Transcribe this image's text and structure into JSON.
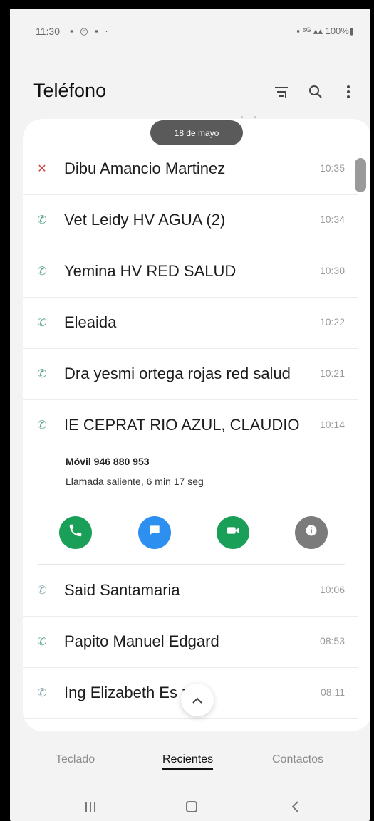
{
  "status_bar": {
    "time": "11:30",
    "left_icons": "▪ ◎ ▪ ·",
    "right_icons": "▪ ⁵ᴳ ▴▴ 100%▮"
  },
  "header": {
    "title": "Teléfono",
    "filter_icon": "filter-icon",
    "search_icon": "search-icon",
    "more_icon": "more-vert-icon"
  },
  "date_label": "18 de mayo",
  "calls_before": [
    {
      "name": "Dibu Amancio Martinez",
      "time": "10:35",
      "type": "missed"
    },
    {
      "name": "Vet Leidy HV AGUA (2)",
      "time": "10:34",
      "type": "incoming"
    },
    {
      "name": "Yemina HV RED SALUD",
      "time": "10:30",
      "type": "incoming"
    },
    {
      "name": "Eleaida",
      "time": "10:22",
      "type": "incoming"
    },
    {
      "name": "Dra yesmi ortega rojas red salud",
      "time": "10:21",
      "type": "incoming"
    },
    {
      "name": "IE CEPRAT RIO AZUL, CLAUDIO",
      "time": "10:14",
      "type": "incoming"
    }
  ],
  "expanded": {
    "number": "Móvil 946 880 953",
    "info": "Llamada saliente, 6 min 17 seg"
  },
  "calls_after": [
    {
      "name": "Said Santamaria",
      "time": "10:06",
      "type": "outgoing"
    },
    {
      "name": "Papito Manuel Edgard",
      "time": "08:53",
      "type": "incoming"
    },
    {
      "name": "Ing Elizabeth Es   za",
      "time": "08:11",
      "type": "outgoing"
    }
  ],
  "tabs": {
    "keypad": "Teclado",
    "recents": "Recientes",
    "contacts": "Contactos"
  },
  "colors": {
    "call_green": "#1a9f58",
    "message_blue": "#2d8ff0",
    "missed_red": "#d94040"
  }
}
